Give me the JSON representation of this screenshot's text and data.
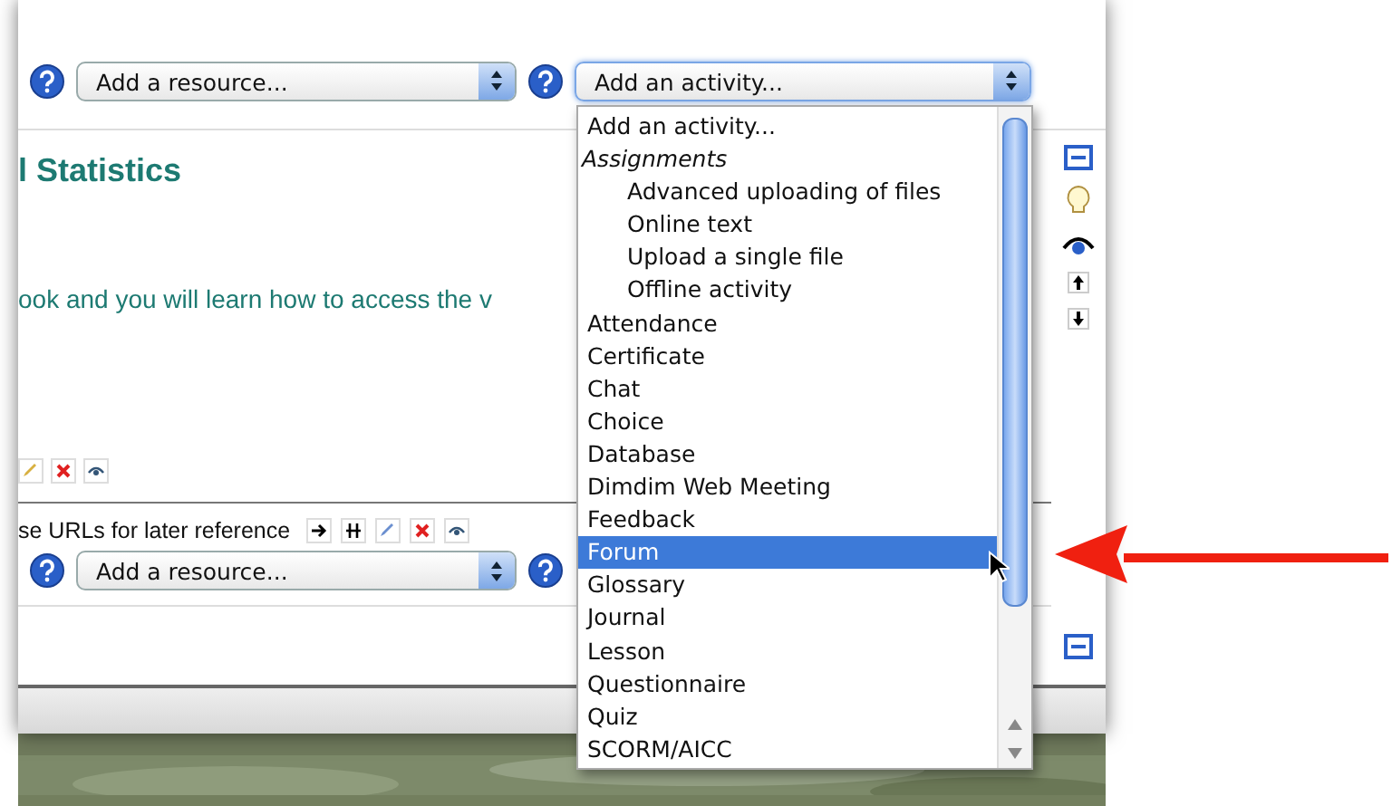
{
  "top_bar": {
    "resource_select": {
      "value": "Add a resource..."
    },
    "activity_select": {
      "value": "Add an activity...",
      "expanded": true
    }
  },
  "section": {
    "title": "l Statistics",
    "text": "ook and you will learn how to access the v"
  },
  "link_row": {
    "text": "se URLs for later reference"
  },
  "bottom_bar": {
    "resource_select": {
      "value": "Add a resource..."
    }
  },
  "activity_menu": {
    "items": [
      {
        "label": "Add an activity...",
        "kind": "option",
        "selected": false
      },
      {
        "label": "Assignments",
        "kind": "group",
        "children": [
          {
            "label": "Advanced uploading of files",
            "selected": false
          },
          {
            "label": "Online text",
            "selected": false
          },
          {
            "label": "Upload a single file",
            "selected": false
          },
          {
            "label": "Offline activity",
            "selected": false
          }
        ]
      },
      {
        "label": "Attendance",
        "kind": "option",
        "selected": false
      },
      {
        "label": "Certificate",
        "kind": "option",
        "selected": false
      },
      {
        "label": "Chat",
        "kind": "option",
        "selected": false
      },
      {
        "label": "Choice",
        "kind": "option",
        "selected": false
      },
      {
        "label": "Database",
        "kind": "option",
        "selected": false
      },
      {
        "label": "Dimdim Web Meeting",
        "kind": "option",
        "selected": false
      },
      {
        "label": "Feedback",
        "kind": "option",
        "selected": false
      },
      {
        "label": "Forum",
        "kind": "option",
        "selected": true
      },
      {
        "label": "Glossary",
        "kind": "option",
        "selected": false
      },
      {
        "label": "Journal",
        "kind": "option",
        "selected": false
      },
      {
        "label": "Lesson",
        "kind": "option",
        "selected": false
      },
      {
        "label": "Questionnaire",
        "kind": "option",
        "selected": false
      },
      {
        "label": "Quiz",
        "kind": "option",
        "selected": false
      },
      {
        "label": "SCORM/AICC",
        "kind": "option",
        "selected": false
      }
    ]
  }
}
